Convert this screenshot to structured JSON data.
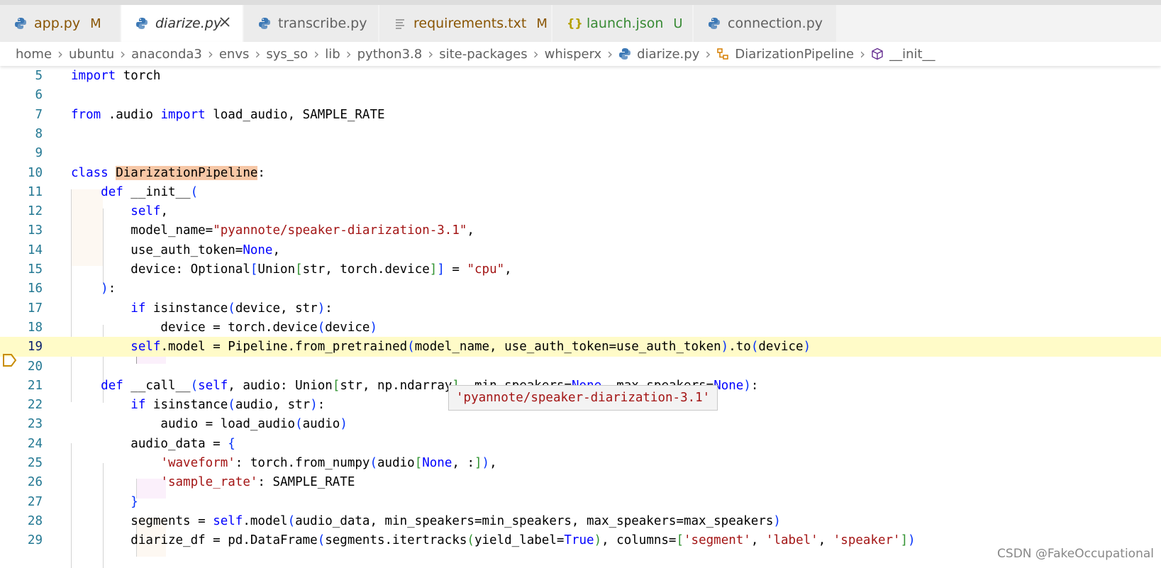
{
  "tabs": [
    {
      "label": "app.py",
      "status": "M",
      "icon": "python-icon",
      "kind": "modified"
    },
    {
      "label": "diarize.py",
      "status": "",
      "icon": "python-icon",
      "kind": "active"
    },
    {
      "label": "transcribe.py",
      "status": "",
      "icon": "python-icon",
      "kind": "plain"
    },
    {
      "label": "requirements.txt",
      "status": "M",
      "icon": "text-file-icon",
      "kind": "modified"
    },
    {
      "label": "launch.json",
      "status": "U",
      "icon": "json-braces-icon",
      "kind": "untracked"
    },
    {
      "label": "connection.py",
      "status": "",
      "icon": "python-icon",
      "kind": "plain"
    }
  ],
  "breadcrumb": [
    "home",
    "ubuntu",
    "anaconda3",
    "envs",
    "sys_so",
    "lib",
    "python3.8",
    "site-packages",
    "whisperx",
    "diarize.py",
    "DiarizationPipeline",
    "__init__"
  ],
  "editor": {
    "current_line": 19,
    "hover_text": "'pyannote/speaker-diarization-3.1'",
    "lines": [
      {
        "num": "5",
        "code": "import torch"
      },
      {
        "num": "6",
        "code": ""
      },
      {
        "num": "7",
        "code": "from .audio import load_audio, SAMPLE_RATE"
      },
      {
        "num": "8",
        "code": ""
      },
      {
        "num": "9",
        "code": ""
      },
      {
        "num": "10",
        "code": "class DiarizationPipeline:"
      },
      {
        "num": "11",
        "code": "    def __init__("
      },
      {
        "num": "12",
        "code": "        self,"
      },
      {
        "num": "13",
        "code": "        model_name=\"pyannote/speaker-diarization-3.1\","
      },
      {
        "num": "14",
        "code": "        use_auth_token=None,"
      },
      {
        "num": "15",
        "code": "        device: Optional[Union[str, torch.device]] = \"cpu\","
      },
      {
        "num": "16",
        "code": "    ):"
      },
      {
        "num": "17",
        "code": "        if isinstance(device, str):"
      },
      {
        "num": "18",
        "code": "            device = torch.device(device)"
      },
      {
        "num": "19",
        "code": "        self.model = Pipeline.from_pretrained(model_name, use_auth_token=use_auth_token).to(device)"
      },
      {
        "num": "20",
        "code": ""
      },
      {
        "num": "21",
        "code": "    def __call__(self, audio: Union[str, np.ndarray], min_speakers=None, max_speakers=None):"
      },
      {
        "num": "22",
        "code": "        if isinstance(audio, str):"
      },
      {
        "num": "23",
        "code": "            audio = load_audio(audio)"
      },
      {
        "num": "24",
        "code": "        audio_data = {"
      },
      {
        "num": "25",
        "code": "            'waveform': torch.from_numpy(audio[None, :]),"
      },
      {
        "num": "26",
        "code": "            'sample_rate': SAMPLE_RATE"
      },
      {
        "num": "27",
        "code": "        }"
      },
      {
        "num": "28",
        "code": "        segments = self.model(audio_data, min_speakers=min_speakers, max_speakers=max_speakers)"
      },
      {
        "num": "29",
        "code": "        diarize_df = pd.DataFrame(segments.itertracks(yield_label=True), columns=['segment', 'label', 'speaker'])"
      }
    ]
  },
  "watermark": "CSDN @FakeOccupational",
  "colors": {
    "keyword": "#0000ff",
    "string": "#a31515",
    "line_number": "#237893",
    "current_line": "#fffbc8",
    "class_highlight": "#f7c7a6"
  }
}
